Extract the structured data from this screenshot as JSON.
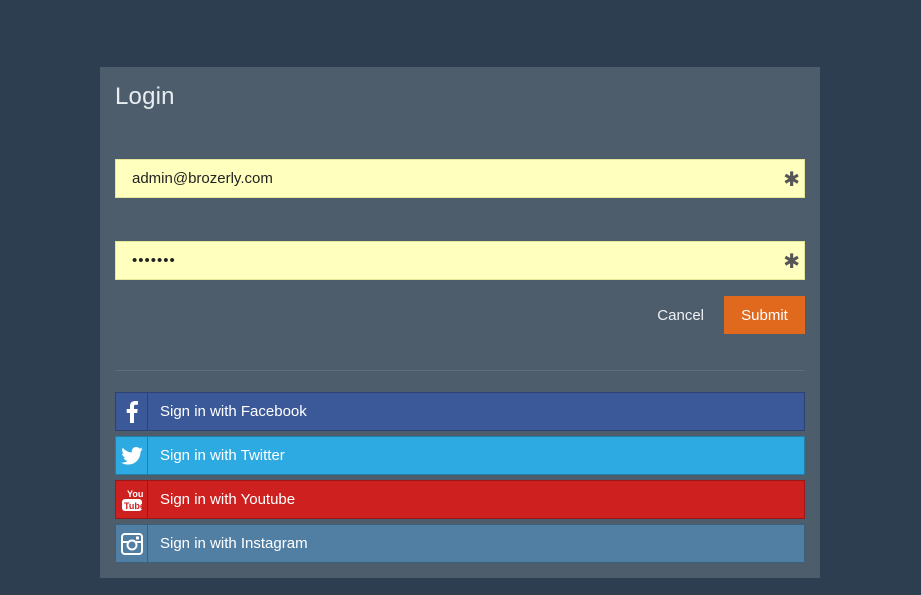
{
  "login": {
    "title": "Login",
    "email_value": "admin@brozerly.com",
    "password_value": "•••••••",
    "required_marker": "✱",
    "cancel_label": "Cancel",
    "submit_label": "Submit"
  },
  "social": [
    {
      "id": "facebook",
      "label": "Sign in with Facebook",
      "icon": "facebook-icon",
      "color": "#3b5998"
    },
    {
      "id": "twitter",
      "label": "Sign in with Twitter",
      "icon": "twitter-icon",
      "color": "#2daae1"
    },
    {
      "id": "youtube",
      "label": "Sign in with Youtube",
      "icon": "youtube-icon",
      "color": "#cd201f"
    },
    {
      "id": "instagram",
      "label": "Sign in with Instagram",
      "icon": "instagram-icon",
      "color": "#517fa4"
    }
  ],
  "colors": {
    "background": "#2c3e50",
    "panel": "#4d5d6c",
    "input_bg": "#ffffbe",
    "submit": "#e1691e"
  }
}
